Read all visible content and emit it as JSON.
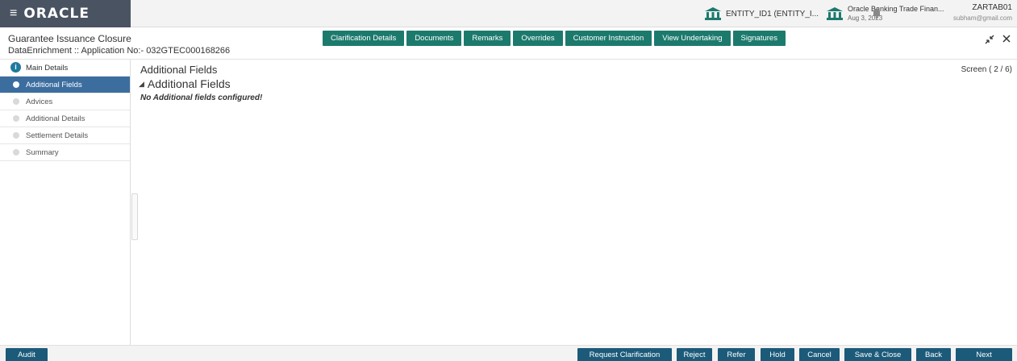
{
  "brand": {
    "logo": "ORACLE"
  },
  "topbar": {
    "entity_label": "ENTITY_ID1 (ENTITY_I...",
    "branch_name": "Oracle Banking Trade Finan...",
    "branch_date": "Aug 3, 2023",
    "user_name": "ZARTAB01",
    "user_email": "subham@gmail.com"
  },
  "header": {
    "title": "Guarantee Issuance Closure",
    "subtitle": "DataEnrichment :: Application No:- 032GTEC000168266",
    "tabs": [
      "Clarification Details",
      "Documents",
      "Remarks",
      "Overrides",
      "Customer Instruction",
      "View Undertaking",
      "Signatures"
    ]
  },
  "sidebar": {
    "steps": [
      {
        "label": "Main Details",
        "marker": "i"
      },
      {
        "label": "Additional Fields"
      },
      {
        "label": "Advices"
      },
      {
        "label": "Additional Details"
      },
      {
        "label": "Settlement Details"
      },
      {
        "label": "Summary"
      }
    ]
  },
  "content": {
    "title": "Additional Fields",
    "screen": "Screen ( 2 / 6)",
    "section_title": "Additional Fields",
    "empty_message": "No Additional fields configured!"
  },
  "footer": {
    "audit": "Audit",
    "request_clarification": "Request Clarification",
    "reject": "Reject",
    "refer": "Refer",
    "hold": "Hold",
    "cancel": "Cancel",
    "save_close": "Save & Close",
    "back": "Back",
    "next": "Next"
  },
  "colors": {
    "tab_bg": "#1c7a6d",
    "active_step_bg": "#3c6d9f",
    "footer_btn_bg": "#1c5a7a",
    "brand_bg": "#4a5362"
  }
}
